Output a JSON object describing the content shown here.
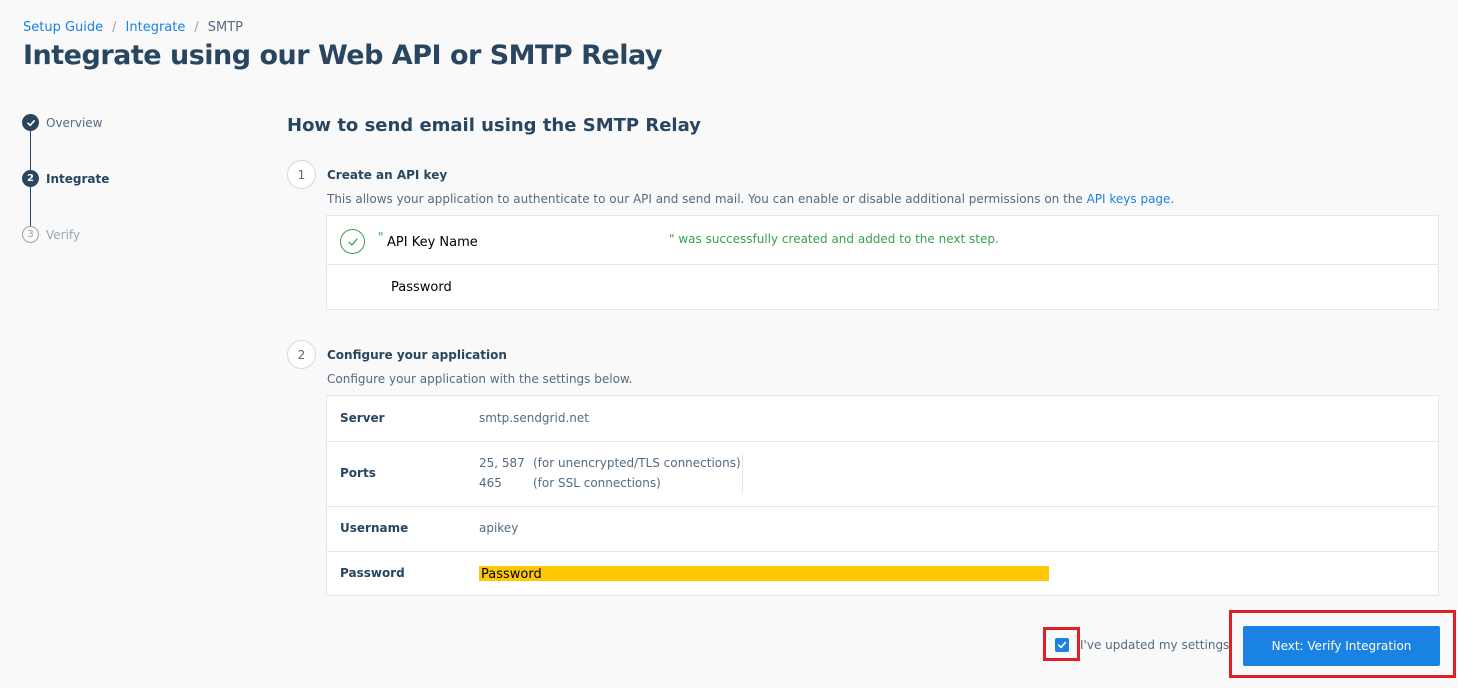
{
  "breadcrumb": {
    "items": [
      "Setup Guide",
      "Integrate",
      "SMTP"
    ],
    "separator": "/"
  },
  "page_title": "Integrate using our Web API or SMTP Relay",
  "stepper": {
    "steps": [
      {
        "number": "",
        "label": "Overview",
        "state": "complete"
      },
      {
        "number": "2",
        "label": "Integrate",
        "state": "active"
      },
      {
        "number": "3",
        "label": "Verify",
        "state": "pending"
      }
    ]
  },
  "section_title": "How to send email using the SMTP Relay",
  "step1": {
    "number": "1",
    "title": "Create an API key",
    "description": "This allows your application to authenticate to our API and send mail. You can enable or disable additional permissions on the ",
    "link_text": "API keys page",
    "description_end": ".",
    "open_quote": "\"",
    "key_name": "API Key Name",
    "success_message": "\" was successfully created and added to the next step.",
    "password_label": "Password"
  },
  "step2": {
    "number": "2",
    "title": "Configure your application",
    "description": "Configure your application with the settings below.",
    "rows": {
      "server": {
        "label": "Server",
        "value": "smtp.sendgrid.net"
      },
      "ports": {
        "label": "Ports",
        "lines": [
          {
            "port": "25, 587",
            "note": "(for unencrypted/TLS connections)"
          },
          {
            "port": "465",
            "note": "(for SSL connections)"
          }
        ]
      },
      "username": {
        "label": "Username",
        "value": "apikey"
      },
      "password": {
        "label": "Password",
        "value": "Password"
      }
    }
  },
  "footer": {
    "checkbox_label": "I've updated my settings.",
    "checkbox_checked": true,
    "next_button": "Next: Verify Integration"
  },
  "colors": {
    "primary": "#1a82e2",
    "success": "#3a9f52",
    "highlight": "#ffc803",
    "annotation": "#e01e26"
  }
}
